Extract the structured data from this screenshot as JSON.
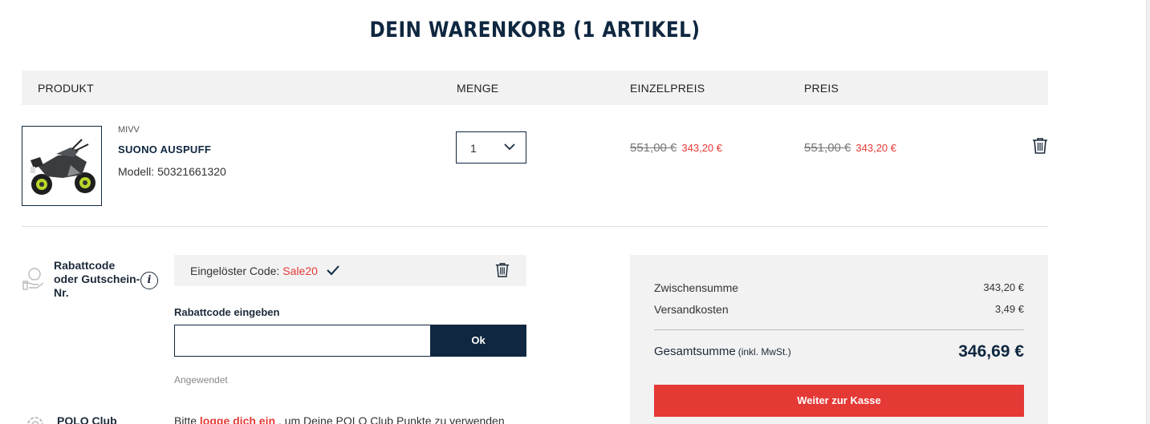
{
  "page": {
    "title": "DEIN WARENKORB (1 ARTIKEL)"
  },
  "table": {
    "headers": {
      "product": "PRODUKT",
      "quantity": "MENGE",
      "unit_price": "EINZELPREIS",
      "price": "PREIS"
    }
  },
  "item": {
    "brand": "MIVV",
    "name": "SUONO AUSPUFF",
    "model_label": "Modell:",
    "model_number": "50321661320",
    "quantity": "1",
    "unit_price_old": "551,00 €",
    "unit_price_new": "343,20 €",
    "price_old": "551,00 €",
    "price_new": "343,20 €"
  },
  "discount": {
    "label": "Rabattcode oder Gutschein-Nr.",
    "redeemed_label": "Eingelöster Code:",
    "redeemed_code": "Sale20",
    "input_label": "Rabattcode eingeben",
    "input_value": "",
    "ok_label": "Ok",
    "status": "Angewendet"
  },
  "polo_club": {
    "label": "POLO Club",
    "text_before": "Bitte ",
    "link": "logge dich ein",
    "text_after": " , um Deine POLO Club Punkte zu verwenden"
  },
  "summary": {
    "subtotal_label": "Zwischensumme",
    "subtotal_value": "343,20 €",
    "shipping_label": "Versandkosten",
    "shipping_value": "3,49 €",
    "total_label": "Gesamtsumme",
    "total_note": "(inkl. MwSt.)",
    "total_value": "346,69 €",
    "checkout_label": "Weiter zur Kasse"
  },
  "colors": {
    "navy": "#0f2740",
    "accent_red": "#e53935",
    "panel_gray": "#f2f2f2"
  },
  "icons": [
    "trash-icon",
    "check-icon",
    "chevron-down-icon",
    "info-icon",
    "discount-hand-icon",
    "gear-icon"
  ]
}
